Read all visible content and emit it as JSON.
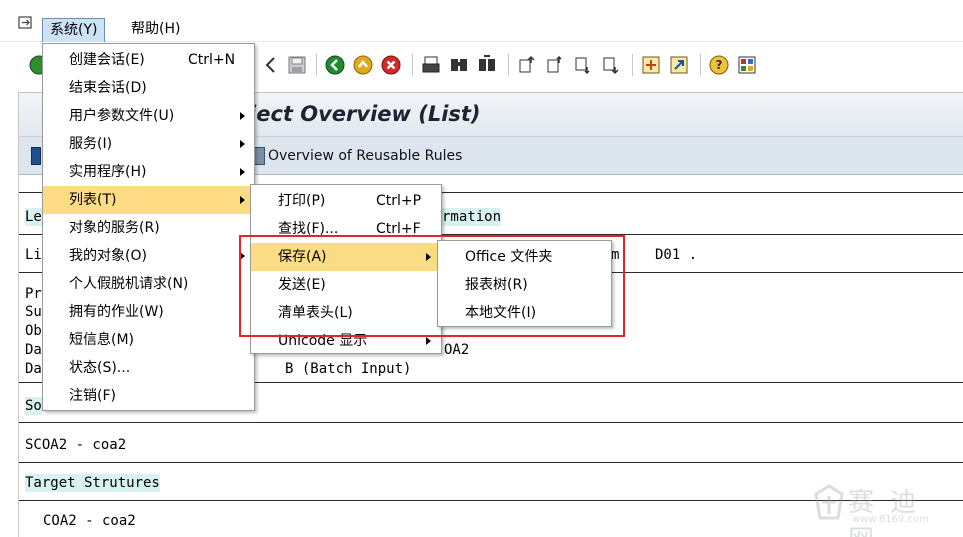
{
  "menubar": {
    "system": "系统(Y)",
    "help": "帮助(H)"
  },
  "screen": {
    "title_visible": "ject Overview (List)",
    "rules_button": "Overview of Reusable Rules"
  },
  "content": {
    "row1_left": "Le",
    "row1_right": "rmation",
    "row2_left": "Li",
    "row2_mid": "m",
    "row2_right": "D01 .",
    "row3": "Pr",
    "row4": "Su",
    "row5": "Ob",
    "row6_left": "Da",
    "row6_right": "OA2",
    "row7_left": "Da",
    "row7_right": "B (Batch Input)",
    "section_source": "So",
    "source_value": "SCOA2 - coa2",
    "section_target": "Target Strutures",
    "target_value": "COA2 - coa2"
  },
  "menu_system": {
    "items": [
      {
        "label": "创建会话(E)",
        "shortcut": "Ctrl+N",
        "submenu": false
      },
      {
        "label": "结束会话(D)",
        "shortcut": "",
        "submenu": false
      },
      {
        "label": "用户参数文件(U)",
        "shortcut": "",
        "submenu": true
      },
      {
        "label": "服务(I)",
        "shortcut": "",
        "submenu": true
      },
      {
        "label": "实用程序(H)",
        "shortcut": "",
        "submenu": true
      },
      {
        "label": "列表(T)",
        "shortcut": "",
        "submenu": true,
        "selected": true
      },
      {
        "label": "对象的服务(R)",
        "shortcut": "",
        "submenu": false
      },
      {
        "label": "我的对象(O)",
        "shortcut": "",
        "submenu": true
      },
      {
        "label": "个人假脱机请求(N)",
        "shortcut": "",
        "submenu": false
      },
      {
        "label": "拥有的作业(W)",
        "shortcut": "",
        "submenu": false
      },
      {
        "label": "短信息(M)",
        "shortcut": "",
        "submenu": false
      },
      {
        "label": "状态(S)...",
        "shortcut": "",
        "submenu": false
      },
      {
        "label": "注销(F)",
        "shortcut": "",
        "submenu": false
      }
    ]
  },
  "menu_list": {
    "items": [
      {
        "label": "打印(P)",
        "shortcut": "Ctrl+P",
        "submenu": false
      },
      {
        "label": "查找(F)...",
        "shortcut": "Ctrl+F",
        "submenu": false
      },
      {
        "label": "保存(A)",
        "shortcut": "",
        "submenu": true,
        "selected": true
      },
      {
        "label": "发送(E)",
        "shortcut": "",
        "submenu": false
      },
      {
        "label": "清单表头(L)",
        "shortcut": "",
        "submenu": false
      },
      {
        "label": "Unicode 显示",
        "shortcut": "",
        "submenu": true
      }
    ]
  },
  "menu_save": {
    "items": [
      {
        "label": "Office 文件夹"
      },
      {
        "label": "报表树(R)"
      },
      {
        "label": "本地文件(I)"
      }
    ]
  },
  "watermark": {
    "main": "赛 迪 网",
    "sub": "www.8169.com"
  },
  "colors": {
    "menu_selected": "#fbdc85",
    "highlight_box": "#e0262b",
    "section_highlight": "#d7f2f0"
  }
}
